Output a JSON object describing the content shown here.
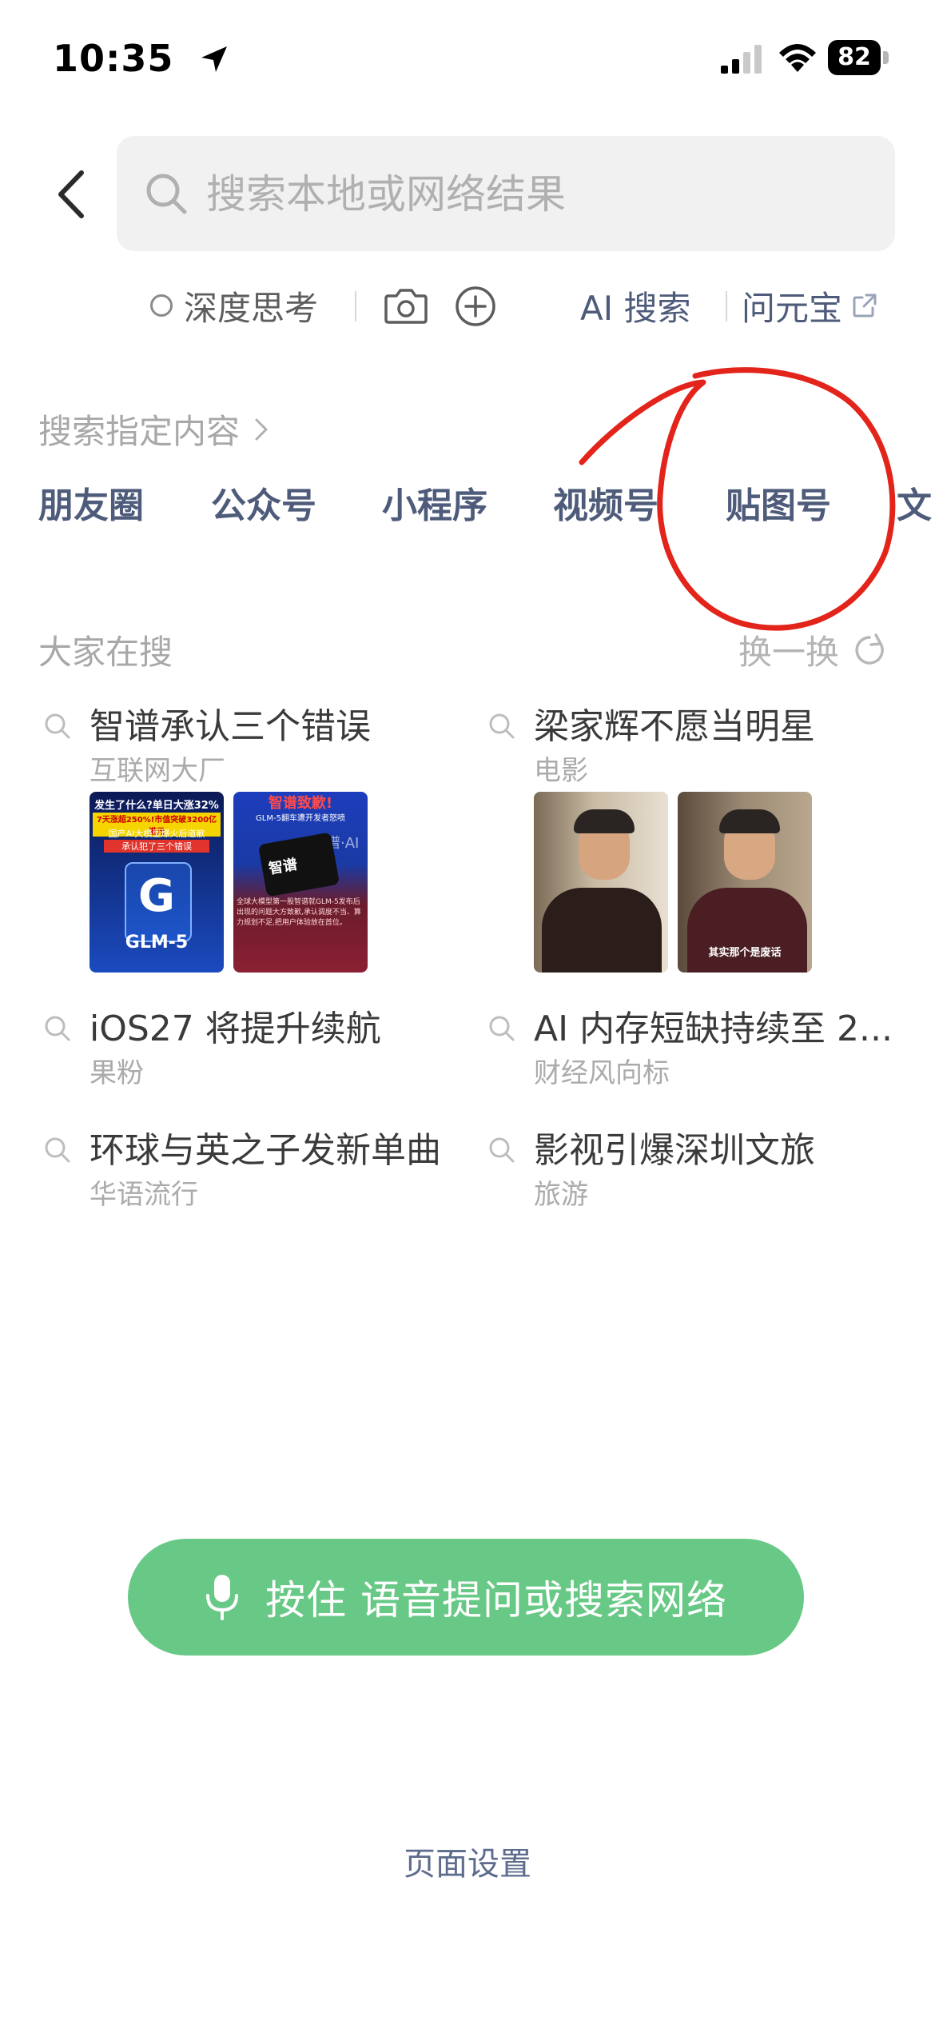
{
  "status_bar": {
    "time": "10:35",
    "battery": "82"
  },
  "search": {
    "placeholder": "搜索本地或网络结果"
  },
  "tools": {
    "deep_think": "深度思考",
    "ai_search": "AI 搜索",
    "wen_yuanbao": "问元宝"
  },
  "designated": {
    "title": "搜索指定内容",
    "categories": [
      "朋友圈",
      "公众号",
      "小程序",
      "视频号",
      "贴图号",
      "文"
    ]
  },
  "trending": {
    "title": "大家在搜",
    "refresh": "换一换",
    "items": [
      {
        "title": "智谱承认三个错误",
        "sub": "互联网大厂"
      },
      {
        "title": "梁家辉不愿当明星",
        "sub": "电影"
      },
      {
        "title": "iOS27 将提升续航",
        "sub": "果粉"
      },
      {
        "title": "AI 内存短缺持续至 2...",
        "sub": "财经风向标"
      },
      {
        "title": "环球与英之子发新单曲",
        "sub": "华语流行"
      },
      {
        "title": "影视引爆深圳文旅",
        "sub": "旅游"
      }
    ],
    "thumbs": {
      "glm_a_top": "发生了什么?单日大涨32%",
      "glm_a_mid": "7天涨超250%!市值突破3200亿港元",
      "glm_a_mid2": "国产AI大模型爆火后道歉",
      "glm_a_mid3": "承认犯了三个错误",
      "glm_a_logo": "G",
      "glm_a_name": "GLM-5",
      "glm_b_top": "智谱致歉!",
      "glm_b_sub": "GLM-5翻车遭开发者怒喷",
      "glm_b_brand": "智谱",
      "glm_b_ai": "智谱·AI",
      "glm_b_body": "全球大模型第一股智谱就GLM-5发布后出现的问题大方致歉,承认调度不当、算力规划不足,把用户体验放在首位。",
      "actor_b_caption": "其实那个是废话"
    }
  },
  "voice_button": {
    "label": "按住 语音提问或搜索网络"
  },
  "footer": {
    "settings": "页面设置"
  },
  "colors": {
    "accent_green": "#67c985",
    "link_blue": "#4e5b7a",
    "annotation_red": "#e3241b"
  }
}
